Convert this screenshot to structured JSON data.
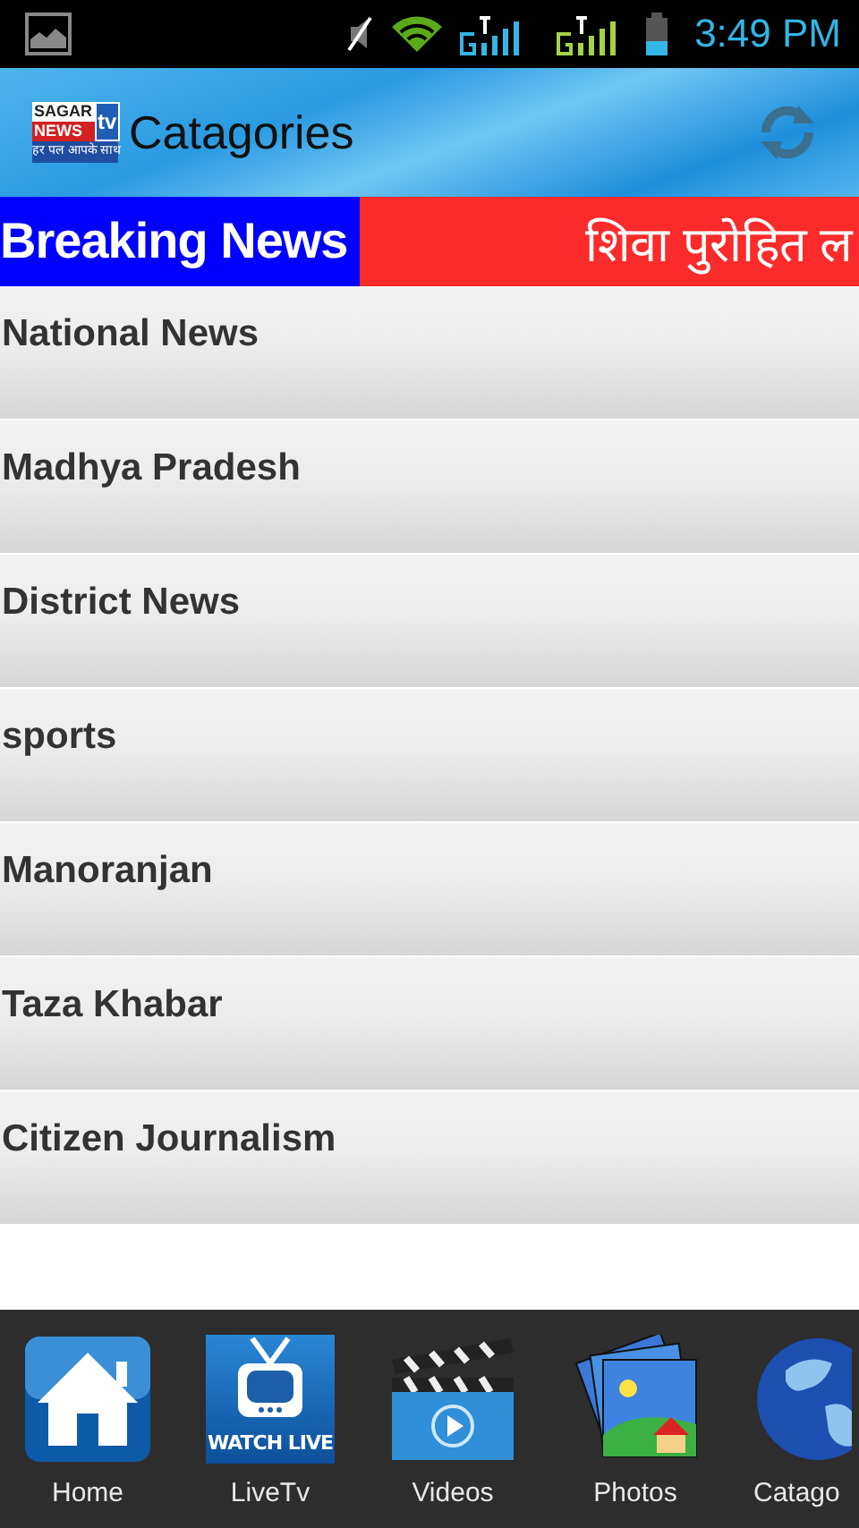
{
  "status_bar": {
    "time": "3:49 PM"
  },
  "header": {
    "logo": {
      "line_1": "SAGAR",
      "line_2": "NEWS",
      "badge": "tv",
      "tagline": "हर पल आपके साथ"
    },
    "title": "Catagories"
  },
  "breaking_news": {
    "label": "Breaking News",
    "ticker": "शिवा पुरोहित ल"
  },
  "categories": [
    {
      "label": "National News"
    },
    {
      "label": "Madhya Pradesh"
    },
    {
      "label": "District News"
    },
    {
      "label": "sports"
    },
    {
      "label": "Manoranjan"
    },
    {
      "label": "Taza Khabar"
    },
    {
      "label": "Citizen Journalism"
    }
  ],
  "bottom_nav": [
    {
      "kind": "home",
      "label": "Home"
    },
    {
      "kind": "live",
      "label": "LiveTv",
      "icon_text": "WATCH LIVE"
    },
    {
      "kind": "videos",
      "label": "Videos"
    },
    {
      "kind": "photos",
      "label": "Photos"
    },
    {
      "kind": "globe",
      "label": "Catago"
    }
  ]
}
